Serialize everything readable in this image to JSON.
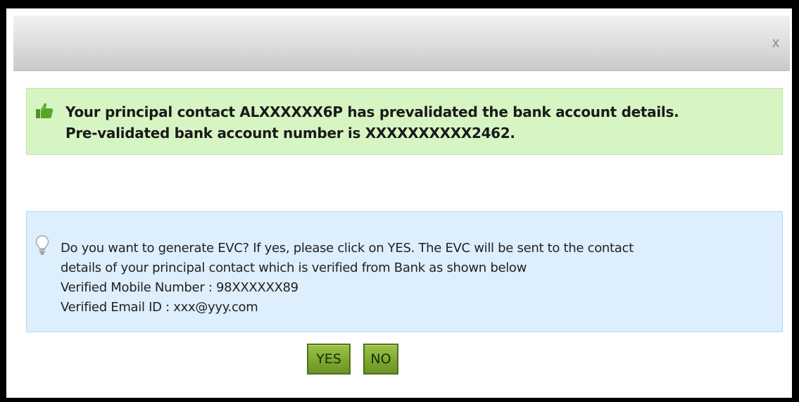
{
  "dialog": {
    "close_label": "x"
  },
  "success_message": {
    "line1": "Your principal contact ALXXXXXX6P has prevalidated the bank account details.",
    "line2": "Pre-validated bank account number is XXXXXXXXXX2462."
  },
  "info_message": {
    "line1": "Do you want to generate EVC? If yes, please click on YES. The EVC will be sent to the contact",
    "line2": "details of your principal contact which is verified from Bank as shown below",
    "line3": "Verified Mobile Number : 98XXXXXX89",
    "line4": "Verified Email ID : xxx@yyy.com"
  },
  "buttons": {
    "yes_label": "YES",
    "no_label": "NO"
  },
  "icons": {
    "success": "thumbs-up-icon",
    "info": "lightbulb-icon",
    "close": "close-icon"
  },
  "colors": {
    "success_bg": "#d6f5c3",
    "info_bg": "#ddeefc",
    "button_green": "#7ea832",
    "thumb_green": "#5aa42a"
  }
}
